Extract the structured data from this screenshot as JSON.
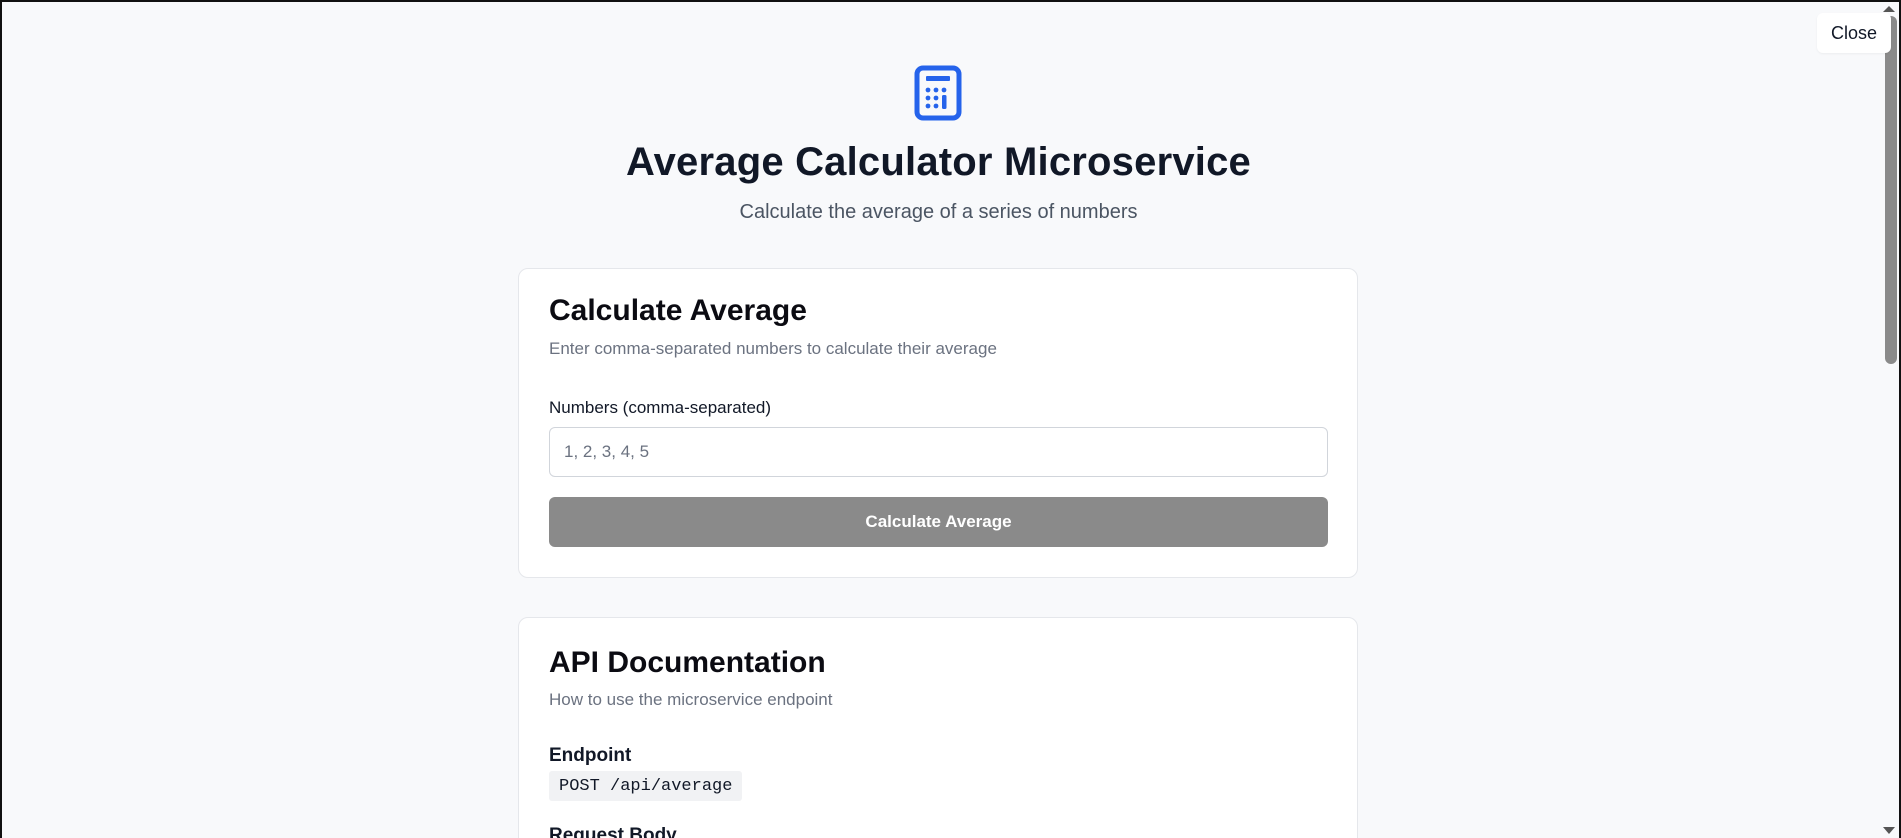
{
  "header": {
    "icon": "calculator-icon",
    "accent": "#2563eb",
    "title": "Average Calculator Microservice",
    "subtitle": "Calculate the average of a series of numbers"
  },
  "close_label": "Close",
  "calculator": {
    "title": "Calculate Average",
    "description": "Enter comma-separated numbers to calculate their average",
    "field_label": "Numbers (comma-separated)",
    "input_placeholder": "1, 2, 3, 4, 5",
    "input_value": "",
    "button_label": "Calculate Average",
    "button_color": "#8a8a8a"
  },
  "api_docs": {
    "title": "API Documentation",
    "description": "How to use the microservice endpoint",
    "endpoint_label": "Endpoint",
    "endpoint_value": "POST /api/average",
    "request_body_label": "Request Body"
  }
}
